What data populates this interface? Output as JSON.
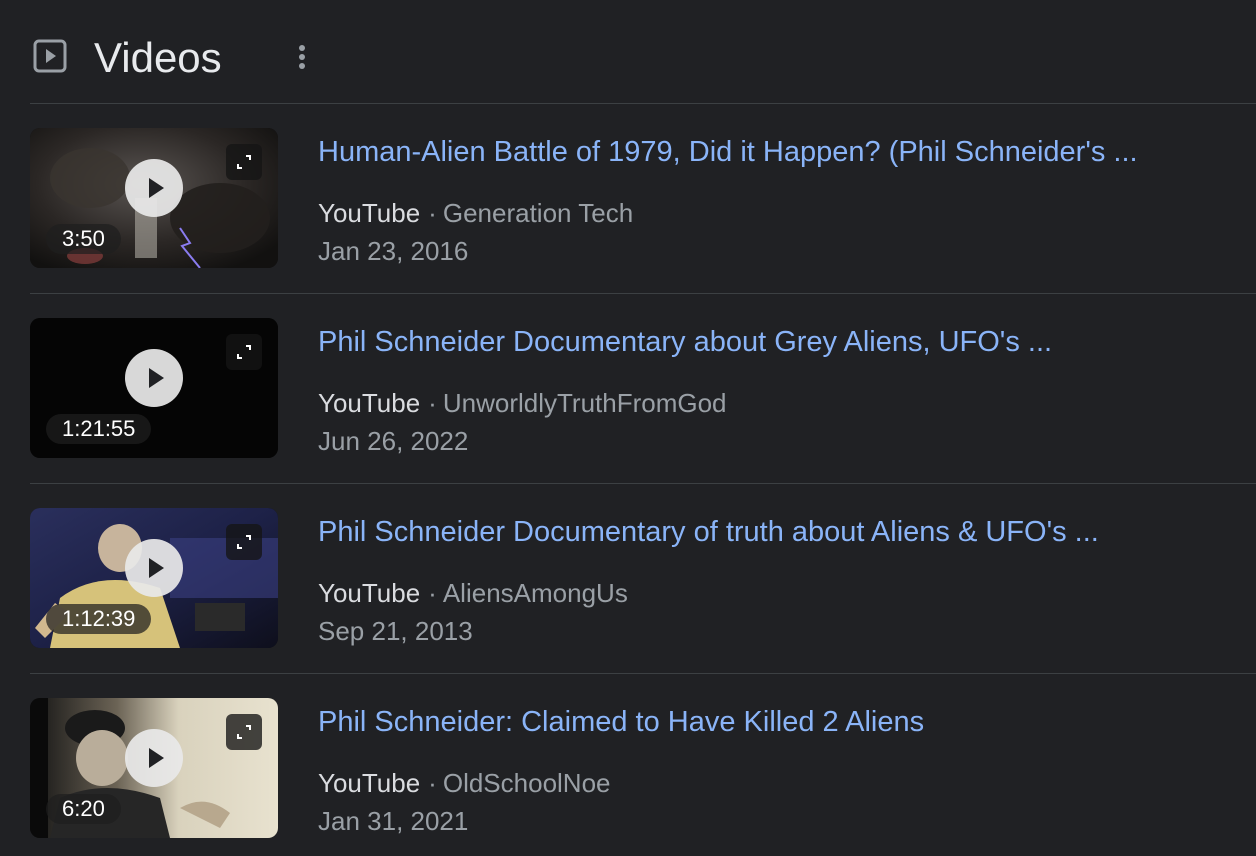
{
  "header": {
    "title": "Videos",
    "icon": "play-box-icon",
    "menu_icon": "more-vert-icon"
  },
  "videos": [
    {
      "title": "Human-Alien Battle of 1979, Did it Happen? (Phil Schneider's ...",
      "source": "YouTube",
      "separator": "·",
      "channel": "Generation Tech",
      "date": "Jan 23, 2016",
      "duration": "3:50"
    },
    {
      "title": "Phil Schneider Documentary about Grey Aliens, UFO's ...",
      "source": "YouTube",
      "separator": "·",
      "channel": "UnworldlyTruthFromGod",
      "date": "Jun 26, 2022",
      "duration": "1:21:55"
    },
    {
      "title": "Phil Schneider Documentary of truth about Aliens & UFO's ...",
      "source": "YouTube",
      "separator": "·",
      "channel": "AliensAmongUs",
      "date": "Sep 21, 2013",
      "duration": "1:12:39"
    },
    {
      "title": "Phil Schneider: Claimed to Have Killed 2 Aliens",
      "source": "YouTube",
      "separator": "·",
      "channel": "OldSchoolNoe",
      "date": "Jan 31, 2021",
      "duration": "6:20"
    }
  ],
  "colors": {
    "background": "#202124",
    "link": "#8ab4f8",
    "primary_text": "#e8eaed",
    "secondary_text": "#9aa0a6",
    "divider": "#3c4043"
  }
}
